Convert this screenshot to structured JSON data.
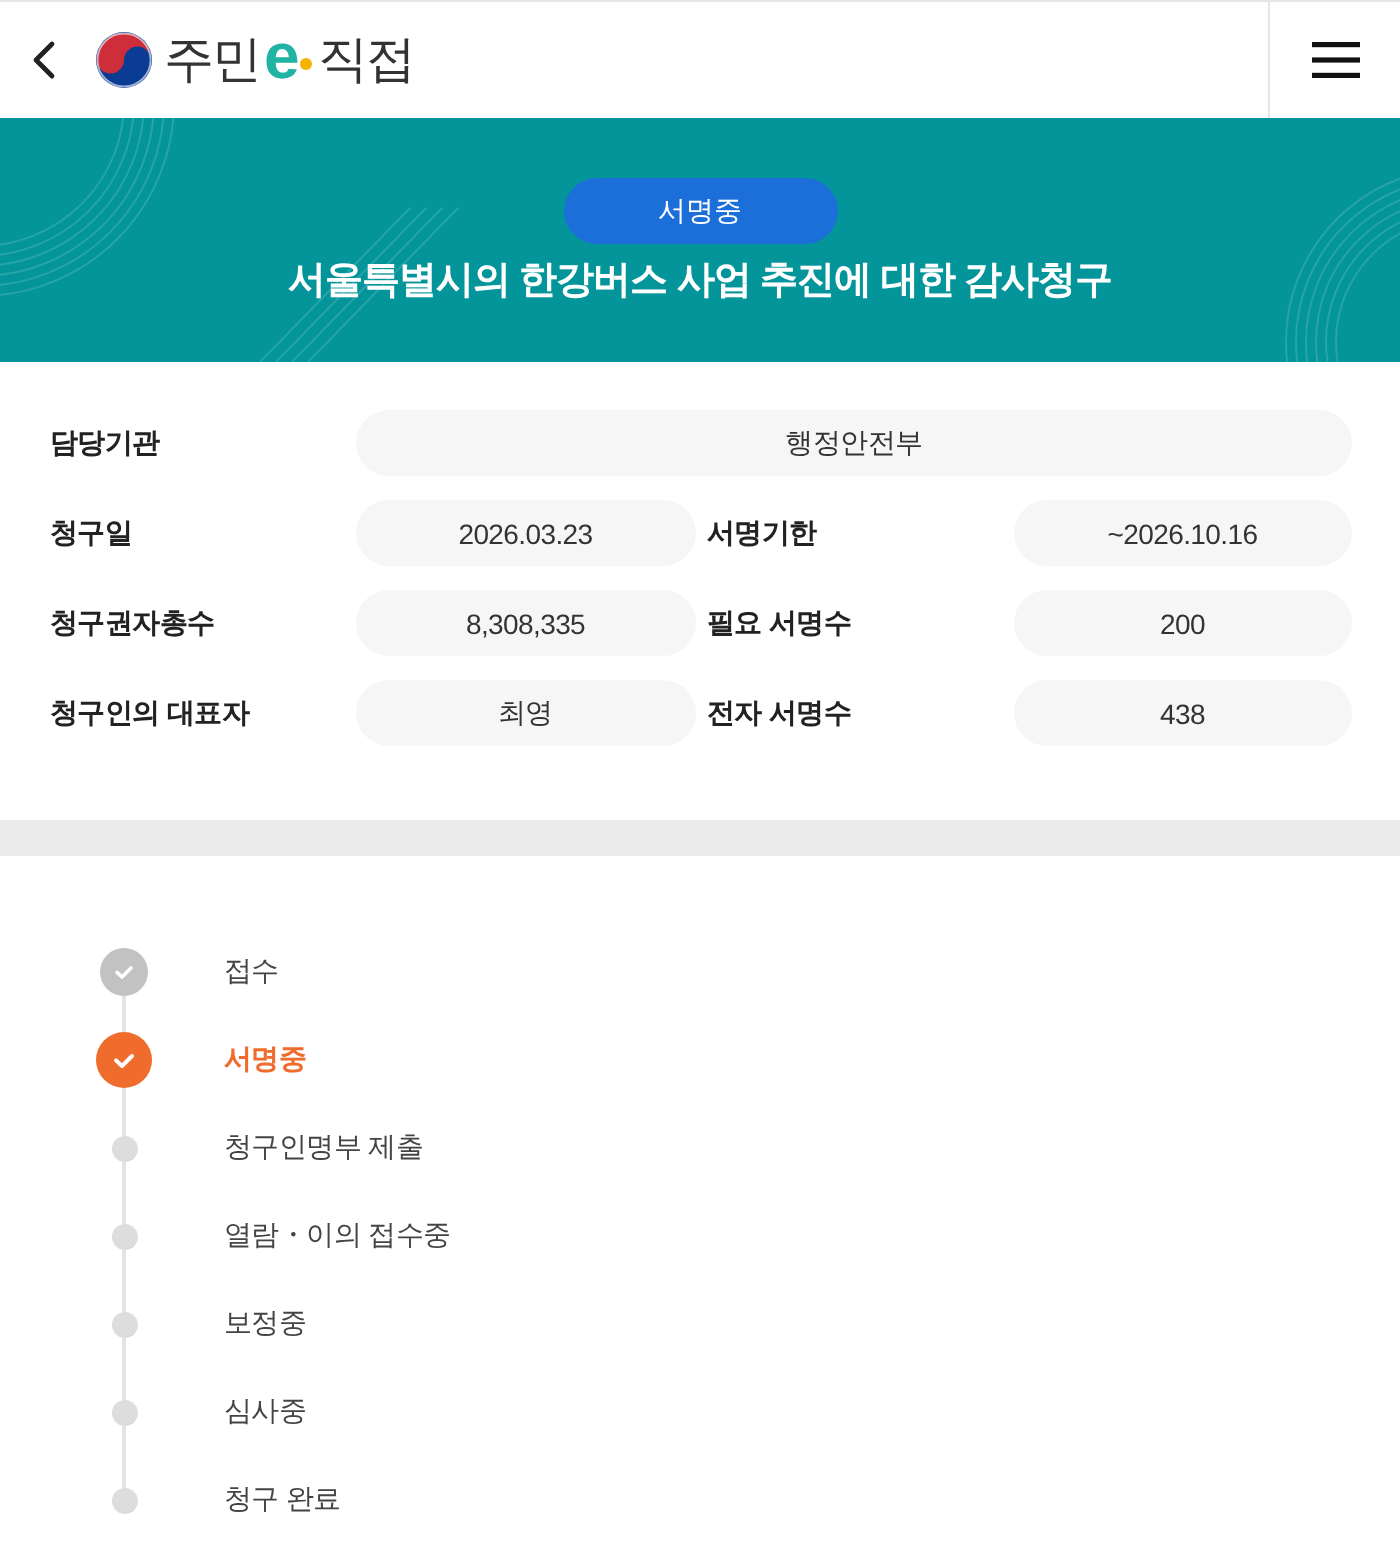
{
  "header": {
    "logo": {
      "text_before": "주민",
      "accent": "e",
      "text_after": "직접"
    }
  },
  "banner": {
    "status_badge": "서명중",
    "title": "서울특별시의 한강버스 사업 추진에 대한 감사청구"
  },
  "info": {
    "rows": [
      {
        "cells": [
          {
            "label": "담당기관",
            "value": "행정안전부"
          }
        ]
      },
      {
        "cells": [
          {
            "label": "청구일",
            "value": "2026.03.23"
          },
          {
            "label": "서명기한",
            "value": "~2026.10.16"
          }
        ]
      },
      {
        "cells": [
          {
            "label": "청구권자총수",
            "value": "8,308,335"
          },
          {
            "label": "필요 서명수",
            "value": "200"
          }
        ]
      },
      {
        "cells": [
          {
            "label": "청구인의 대표자",
            "value": "최영"
          },
          {
            "label": "전자 서명수",
            "value": "438"
          }
        ]
      }
    ]
  },
  "steps": [
    {
      "label": "접수",
      "kind": "done"
    },
    {
      "label": "서명중",
      "kind": "current"
    },
    {
      "label": "청구인명부 제출",
      "kind": "pending"
    },
    {
      "label": "열람・이의 접수중",
      "kind": "pending"
    },
    {
      "label": "보정중",
      "kind": "pending"
    },
    {
      "label": "심사중",
      "kind": "pending"
    },
    {
      "label": "청구 완료",
      "kind": "pending"
    }
  ]
}
